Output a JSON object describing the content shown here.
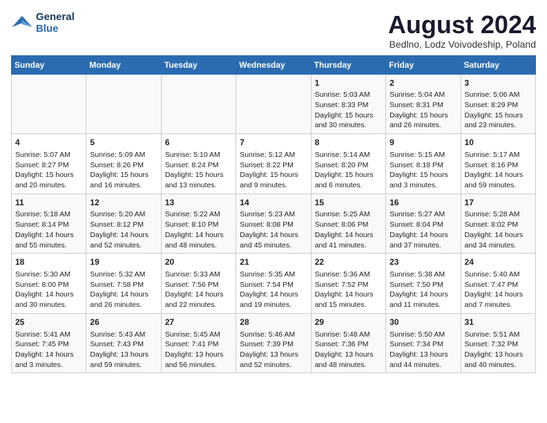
{
  "header": {
    "logo_line1": "General",
    "logo_line2": "Blue",
    "month_title": "August 2024",
    "location": "Bedlno, Lodz Voivodeship, Poland"
  },
  "days_of_week": [
    "Sunday",
    "Monday",
    "Tuesday",
    "Wednesday",
    "Thursday",
    "Friday",
    "Saturday"
  ],
  "weeks": [
    [
      {
        "day": "",
        "info": ""
      },
      {
        "day": "",
        "info": ""
      },
      {
        "day": "",
        "info": ""
      },
      {
        "day": "",
        "info": ""
      },
      {
        "day": "1",
        "info": "Sunrise: 5:03 AM\nSunset: 8:33 PM\nDaylight: 15 hours\nand 30 minutes."
      },
      {
        "day": "2",
        "info": "Sunrise: 5:04 AM\nSunset: 8:31 PM\nDaylight: 15 hours\nand 26 minutes."
      },
      {
        "day": "3",
        "info": "Sunrise: 5:06 AM\nSunset: 8:29 PM\nDaylight: 15 hours\nand 23 minutes."
      }
    ],
    [
      {
        "day": "4",
        "info": "Sunrise: 5:07 AM\nSunset: 8:27 PM\nDaylight: 15 hours\nand 20 minutes."
      },
      {
        "day": "5",
        "info": "Sunrise: 5:09 AM\nSunset: 8:26 PM\nDaylight: 15 hours\nand 16 minutes."
      },
      {
        "day": "6",
        "info": "Sunrise: 5:10 AM\nSunset: 8:24 PM\nDaylight: 15 hours\nand 13 minutes."
      },
      {
        "day": "7",
        "info": "Sunrise: 5:12 AM\nSunset: 8:22 PM\nDaylight: 15 hours\nand 9 minutes."
      },
      {
        "day": "8",
        "info": "Sunrise: 5:14 AM\nSunset: 8:20 PM\nDaylight: 15 hours\nand 6 minutes."
      },
      {
        "day": "9",
        "info": "Sunrise: 5:15 AM\nSunset: 8:18 PM\nDaylight: 15 hours\nand 3 minutes."
      },
      {
        "day": "10",
        "info": "Sunrise: 5:17 AM\nSunset: 8:16 PM\nDaylight: 14 hours\nand 59 minutes."
      }
    ],
    [
      {
        "day": "11",
        "info": "Sunrise: 5:18 AM\nSunset: 8:14 PM\nDaylight: 14 hours\nand 55 minutes."
      },
      {
        "day": "12",
        "info": "Sunrise: 5:20 AM\nSunset: 8:12 PM\nDaylight: 14 hours\nand 52 minutes."
      },
      {
        "day": "13",
        "info": "Sunrise: 5:22 AM\nSunset: 8:10 PM\nDaylight: 14 hours\nand 48 minutes."
      },
      {
        "day": "14",
        "info": "Sunrise: 5:23 AM\nSunset: 8:08 PM\nDaylight: 14 hours\nand 45 minutes."
      },
      {
        "day": "15",
        "info": "Sunrise: 5:25 AM\nSunset: 8:06 PM\nDaylight: 14 hours\nand 41 minutes."
      },
      {
        "day": "16",
        "info": "Sunrise: 5:27 AM\nSunset: 8:04 PM\nDaylight: 14 hours\nand 37 minutes."
      },
      {
        "day": "17",
        "info": "Sunrise: 5:28 AM\nSunset: 8:02 PM\nDaylight: 14 hours\nand 34 minutes."
      }
    ],
    [
      {
        "day": "18",
        "info": "Sunrise: 5:30 AM\nSunset: 8:00 PM\nDaylight: 14 hours\nand 30 minutes."
      },
      {
        "day": "19",
        "info": "Sunrise: 5:32 AM\nSunset: 7:58 PM\nDaylight: 14 hours\nand 26 minutes."
      },
      {
        "day": "20",
        "info": "Sunrise: 5:33 AM\nSunset: 7:56 PM\nDaylight: 14 hours\nand 22 minutes."
      },
      {
        "day": "21",
        "info": "Sunrise: 5:35 AM\nSunset: 7:54 PM\nDaylight: 14 hours\nand 19 minutes."
      },
      {
        "day": "22",
        "info": "Sunrise: 5:36 AM\nSunset: 7:52 PM\nDaylight: 14 hours\nand 15 minutes."
      },
      {
        "day": "23",
        "info": "Sunrise: 5:38 AM\nSunset: 7:50 PM\nDaylight: 14 hours\nand 11 minutes."
      },
      {
        "day": "24",
        "info": "Sunrise: 5:40 AM\nSunset: 7:47 PM\nDaylight: 14 hours\nand 7 minutes."
      }
    ],
    [
      {
        "day": "25",
        "info": "Sunrise: 5:41 AM\nSunset: 7:45 PM\nDaylight: 14 hours\nand 3 minutes."
      },
      {
        "day": "26",
        "info": "Sunrise: 5:43 AM\nSunset: 7:43 PM\nDaylight: 13 hours\nand 59 minutes."
      },
      {
        "day": "27",
        "info": "Sunrise: 5:45 AM\nSunset: 7:41 PM\nDaylight: 13 hours\nand 56 minutes."
      },
      {
        "day": "28",
        "info": "Sunrise: 5:46 AM\nSunset: 7:39 PM\nDaylight: 13 hours\nand 52 minutes."
      },
      {
        "day": "29",
        "info": "Sunrise: 5:48 AM\nSunset: 7:36 PM\nDaylight: 13 hours\nand 48 minutes."
      },
      {
        "day": "30",
        "info": "Sunrise: 5:50 AM\nSunset: 7:34 PM\nDaylight: 13 hours\nand 44 minutes."
      },
      {
        "day": "31",
        "info": "Sunrise: 5:51 AM\nSunset: 7:32 PM\nDaylight: 13 hours\nand 40 minutes."
      }
    ]
  ]
}
